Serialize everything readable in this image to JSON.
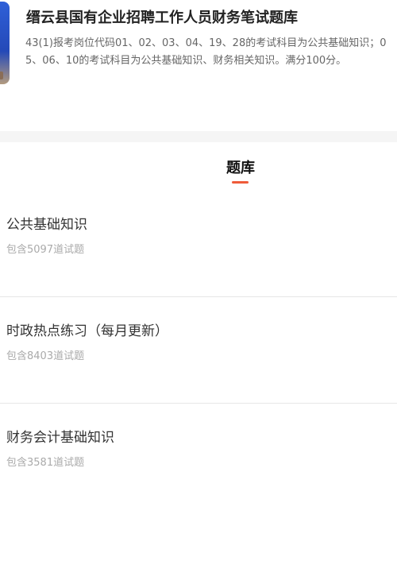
{
  "header": {
    "title": "缙云县国有企业招聘工作人员财务笔试题库",
    "description": "43(1)报考岗位代码01、02、03、04、19、28的考试科目为公共基础知识；05、06、10的考试科目为公共基础知识、财务相关知识。满分100分。"
  },
  "section": {
    "title": "题库"
  },
  "banks": [
    {
      "name": "公共基础知识",
      "count": "包含5097道试题"
    },
    {
      "name": "时政热点练习（每月更新）",
      "count": "包含8403道试题"
    },
    {
      "name": "财务会计基础知识",
      "count": "包含3581道试题"
    }
  ],
  "colors": {
    "accent": "#ef5b3a",
    "cover": "#2f60d8"
  }
}
